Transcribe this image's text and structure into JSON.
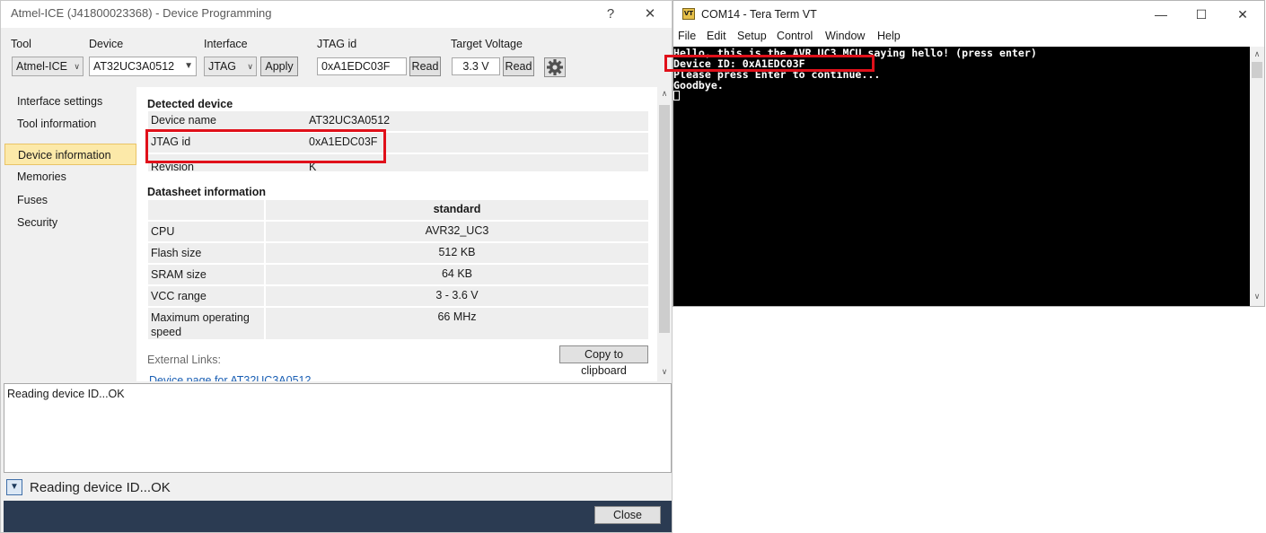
{
  "device_programming": {
    "title": "Atmel-ICE (J41800023368) - Device Programming",
    "help_label": "?",
    "close_label": "✕",
    "toolbar": {
      "tool_label": "Tool",
      "tool_value": "Atmel-ICE",
      "device_label": "Device",
      "device_value": "AT32UC3A0512",
      "interface_label": "Interface",
      "interface_value": "JTAG",
      "apply_label": "Apply",
      "jtag_label": "JTAG id",
      "jtag_value": "0xA1EDC03F",
      "jtag_read_label": "Read",
      "voltage_label": "Target Voltage",
      "voltage_value": "3.3 V",
      "voltage_read_label": "Read",
      "settings_icon": "gear-icon"
    },
    "sidebar": {
      "items": [
        {
          "label": "Interface settings"
        },
        {
          "label": "Tool information"
        },
        {
          "label": "Device information",
          "active": true
        },
        {
          "label": "Memories"
        },
        {
          "label": "Fuses"
        },
        {
          "label": "Security"
        }
      ]
    },
    "detected_device": {
      "title": "Detected device",
      "rows": [
        {
          "key": "Device name",
          "value": "AT32UC3A0512"
        },
        {
          "key": "JTAG id",
          "value": "0xA1EDC03F"
        },
        {
          "key": "Revision",
          "value": "K"
        }
      ]
    },
    "datasheet": {
      "title": "Datasheet information",
      "column_header": "standard",
      "rows": [
        {
          "key": "CPU",
          "value": "AVR32_UC3"
        },
        {
          "key": "Flash size",
          "value": "512 KB"
        },
        {
          "key": "SRAM size",
          "value": "64 KB"
        },
        {
          "key": "VCC range",
          "value": "3 - 3.6 V"
        },
        {
          "key": "Maximum operating speed",
          "value": "66 MHz"
        }
      ]
    },
    "copy_button": "Copy to clipboard",
    "external_links_label": "External Links:",
    "external_link": "Device page for AT32UC3A0512",
    "log_text": "Reading device ID...OK",
    "status_text": "Reading device ID...OK",
    "close_button": "Close",
    "highlight_color": "#e0101a"
  },
  "tera_term": {
    "title": "COM14 - Tera Term VT",
    "app_icon_text": "VT",
    "menu": [
      "File",
      "Edit",
      "Setup",
      "Control",
      "Window",
      "Help"
    ],
    "window_buttons": {
      "minimize": "—",
      "maximize": "☐",
      "close": "✕"
    },
    "lines": [
      "Hello, this is the AVR UC3 MCU saying hello! (press enter)",
      "Device ID: 0xA1EDC03F",
      "Please press Enter to continue...",
      "Goodbye."
    ]
  }
}
